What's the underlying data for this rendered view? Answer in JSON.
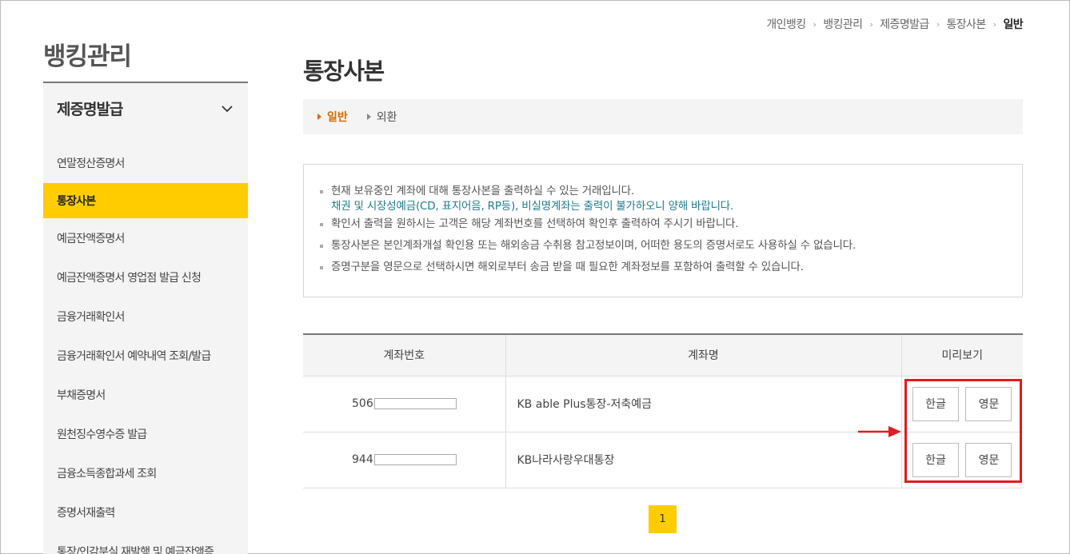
{
  "sidebar": {
    "title": "뱅킹관리",
    "section": "제증명발급",
    "items": [
      {
        "label": "연말정산증명서"
      },
      {
        "label": "통장사본"
      },
      {
        "label": "예금잔액증명서"
      },
      {
        "label": "예금잔액증명서 영업점 발급 신청"
      },
      {
        "label": "금융거래확인서"
      },
      {
        "label": "금융거래확인서 예약내역 조회/발급"
      },
      {
        "label": "부채증명서"
      },
      {
        "label": "원천징수영수증 발급"
      },
      {
        "label": "금융소득종합과세 조회"
      },
      {
        "label": "증명서재출력"
      },
      {
        "label": "통장/인감분실 재발행 및 예금잔액증"
      }
    ],
    "active_index": 1
  },
  "breadcrumb": [
    "개인뱅킹",
    "뱅킹관리",
    "제증명발급",
    "통장사본",
    "일반"
  ],
  "page_title": "통장사본",
  "tabs": [
    {
      "label": "일반",
      "active": true
    },
    {
      "label": "외환",
      "active": false
    }
  ],
  "notice": {
    "line1": "현재 보유중인 계좌에 대해 통장사본을 출력하실 수 있는 거래입니다.",
    "line1_sub": "채권 및 시장성예금(CD, 표지어음, RP등), 비실명계좌는 출력이 불가하오니 양해 바랍니다.",
    "line2": "확인서 출력을 원하시는 고객은 해당 계좌번호를 선택하여 확인후 출력하여 주시기 바랍니다.",
    "line3": "통장사본은 본인계좌개설 확인용 또는 해외송금 수취용 참고정보이며, 어떠한 용도의 증명서로도 사용하실 수 없습니다.",
    "line4": "증명구분을 영문으로 선택하시면 해외로부터 송금 받을 때 필요한 계좌정보를 포함하여 출력할 수 있습니다."
  },
  "table": {
    "headers": [
      "계좌번호",
      "계좌명",
      "미리보기"
    ],
    "rows": [
      {
        "account_prefix": "506",
        "name": "KB able Plus통장-저축예금",
        "btn_ko": "한글",
        "btn_en": "영문"
      },
      {
        "account_prefix": "944",
        "name": "KB나라사랑우대통장",
        "btn_ko": "한글",
        "btn_en": "영문"
      }
    ]
  },
  "pagination": {
    "current": "1"
  },
  "colors": {
    "accent": "#ffcc00",
    "tab_active": "#d56a00",
    "notice_blue": "#1f7a8c",
    "highlight": "#e01c1c"
  }
}
